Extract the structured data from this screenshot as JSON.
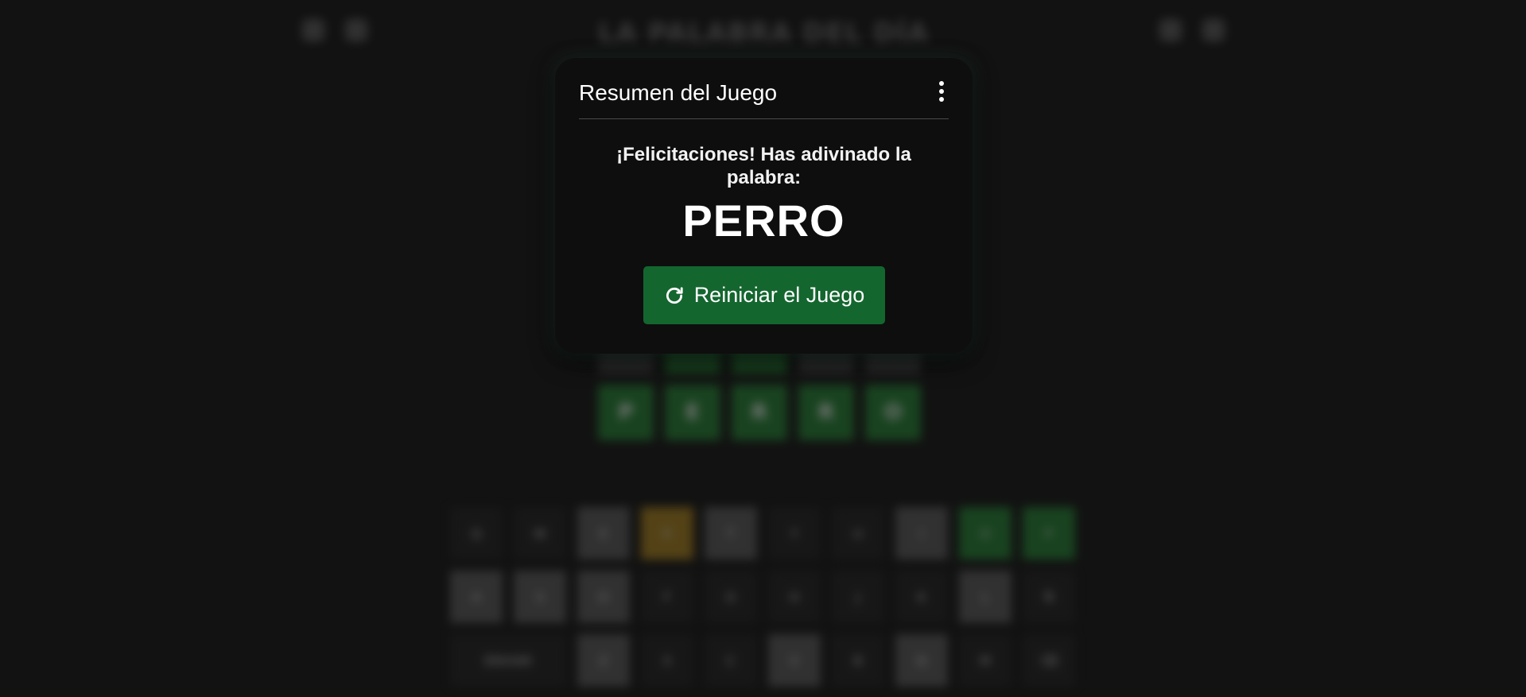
{
  "background": {
    "title": "LA PALABRA DEL DÍA",
    "board": {
      "rows": [
        [
          {
            "letter": "",
            "state": "gray"
          },
          {
            "letter": "",
            "state": "green"
          },
          {
            "letter": "",
            "state": "green"
          },
          {
            "letter": "",
            "state": "gray"
          },
          {
            "letter": "",
            "state": "gray"
          }
        ],
        [
          {
            "letter": "P",
            "state": "green"
          },
          {
            "letter": "E",
            "state": "green"
          },
          {
            "letter": "R",
            "state": "green"
          },
          {
            "letter": "R",
            "state": "green"
          },
          {
            "letter": "O",
            "state": "green"
          }
        ]
      ]
    },
    "keyboard": {
      "rows": [
        [
          {
            "key": "Q",
            "state": "empty"
          },
          {
            "key": "W",
            "state": "empty"
          },
          {
            "key": "E",
            "state": "gray"
          },
          {
            "key": "R",
            "state": "yellow"
          },
          {
            "key": "T",
            "state": "gray"
          },
          {
            "key": "Y",
            "state": "empty"
          },
          {
            "key": "U",
            "state": "empty"
          },
          {
            "key": "I",
            "state": "gray"
          },
          {
            "key": "O",
            "state": "green"
          },
          {
            "key": "P",
            "state": "green"
          }
        ],
        [
          {
            "key": "A",
            "state": "gray"
          },
          {
            "key": "S",
            "state": "gray"
          },
          {
            "key": "D",
            "state": "gray"
          },
          {
            "key": "F",
            "state": "empty"
          },
          {
            "key": "G",
            "state": "empty"
          },
          {
            "key": "H",
            "state": "empty"
          },
          {
            "key": "J",
            "state": "empty"
          },
          {
            "key": "K",
            "state": "empty"
          },
          {
            "key": "L",
            "state": "gray"
          },
          {
            "key": "Ñ",
            "state": "empty"
          }
        ],
        [
          {
            "key": "ENVIAR",
            "state": "empty",
            "wide": true
          },
          {
            "key": "Z",
            "state": "gray"
          },
          {
            "key": "X",
            "state": "empty"
          },
          {
            "key": "C",
            "state": "empty"
          },
          {
            "key": "V",
            "state": "gray"
          },
          {
            "key": "B",
            "state": "empty"
          },
          {
            "key": "N",
            "state": "gray"
          },
          {
            "key": "M",
            "state": "empty"
          },
          {
            "key": "⌫",
            "state": "empty"
          }
        ]
      ]
    }
  },
  "modal": {
    "title": "Resumen del Juego",
    "menu_icon": "more-vertical-icon",
    "message": "¡Felicitaciones! Has adivinado la palabra:",
    "word": "PERRO",
    "restart_icon": "refresh-icon",
    "restart_label": "Reiniciar el Juego",
    "accent_color": "#14662f"
  }
}
